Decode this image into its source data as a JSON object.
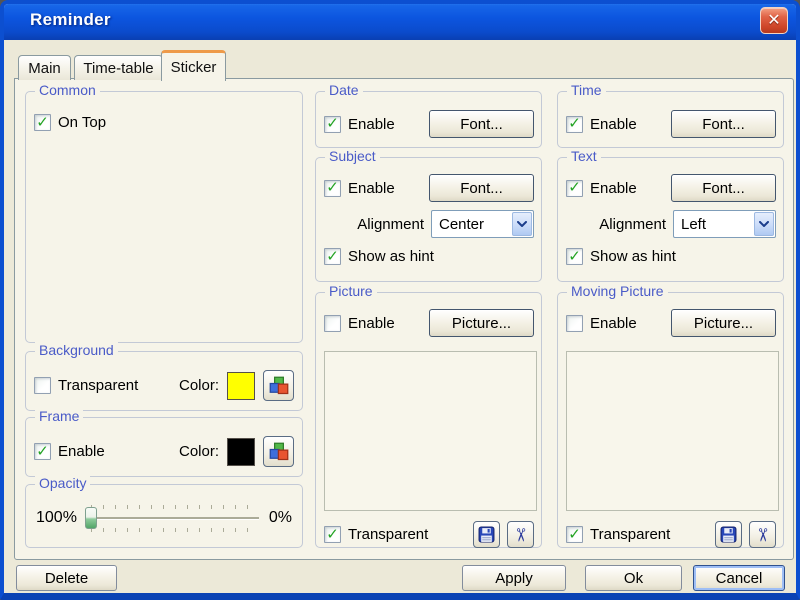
{
  "window": {
    "title": "Reminder"
  },
  "icons": {
    "close": "✕",
    "cut": "✂",
    "checkmark": "✓"
  },
  "tabs": [
    {
      "label": "Main",
      "active": false
    },
    {
      "label": "Time-table",
      "active": false
    },
    {
      "label": "Sticker",
      "active": true
    }
  ],
  "groups": {
    "common": {
      "title": "Common",
      "on_top": {
        "label": "On Top",
        "checked": true
      }
    },
    "background": {
      "title": "Background",
      "transparent": {
        "label": "Transparent",
        "checked": false
      },
      "color_label": "Color:",
      "color_value": "#FFFF00"
    },
    "frame": {
      "title": "Frame",
      "enable": {
        "label": "Enable",
        "checked": true
      },
      "color_label": "Color:",
      "color_value": "#000000"
    },
    "opacity": {
      "title": "Opacity",
      "max_label": "100%",
      "min_label": "0%",
      "value": 100
    },
    "date": {
      "title": "Date",
      "enable": {
        "label": "Enable",
        "checked": true
      },
      "font_button": "Font..."
    },
    "time": {
      "title": "Time",
      "enable": {
        "label": "Enable",
        "checked": true
      },
      "font_button": "Font..."
    },
    "subject": {
      "title": "Subject",
      "enable": {
        "label": "Enable",
        "checked": true
      },
      "font_button": "Font...",
      "alignment_label": "Alignment",
      "alignment_value": "Center",
      "show_as_hint": {
        "label": "Show as hint",
        "checked": true
      }
    },
    "text": {
      "title": "Text",
      "enable": {
        "label": "Enable",
        "checked": true
      },
      "font_button": "Font...",
      "alignment_label": "Alignment",
      "alignment_value": "Left",
      "show_as_hint": {
        "label": "Show as hint",
        "checked": true
      }
    },
    "picture": {
      "title": "Picture",
      "enable": {
        "label": "Enable",
        "checked": false
      },
      "picture_button": "Picture...",
      "transparent": {
        "label": "Transparent",
        "checked": true
      }
    },
    "moving_picture": {
      "title": "Moving Picture",
      "enable": {
        "label": "Enable",
        "checked": false
      },
      "picture_button": "Picture...",
      "transparent": {
        "label": "Transparent",
        "checked": true
      }
    }
  },
  "footer": {
    "delete": "Delete",
    "apply": "Apply",
    "ok": "Ok",
    "cancel": "Cancel"
  },
  "colors": {
    "titlebar_blue": "#0C55DF",
    "dialog_bg": "#ECE9D8",
    "group_label_blue": "#4A5BC8",
    "active_tab_accent": "#EE9A49",
    "background_swatch": "#FFFF00",
    "frame_swatch": "#000000"
  }
}
